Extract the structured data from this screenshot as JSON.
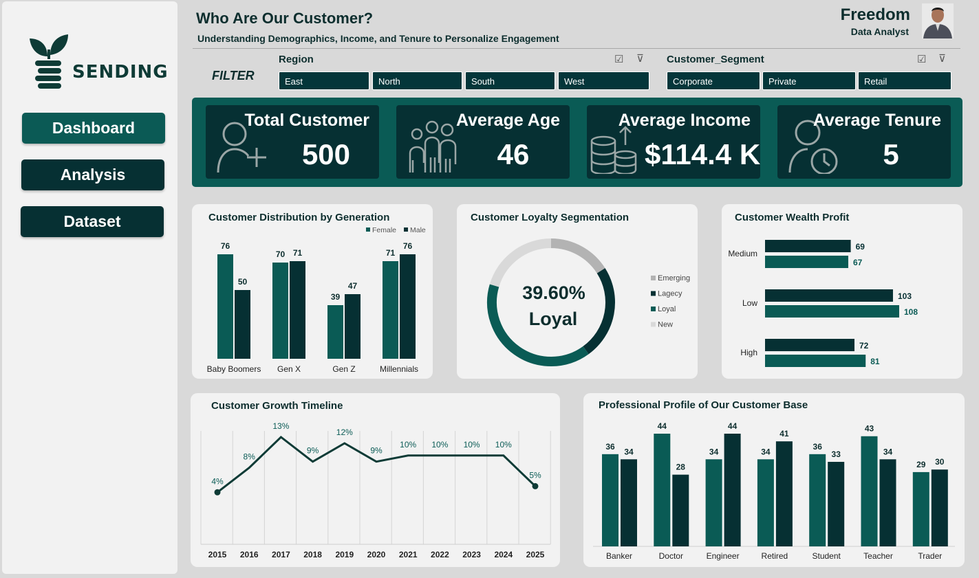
{
  "sidebar": {
    "logo_text": "SENDING",
    "nav": [
      {
        "label": "Dashboard"
      },
      {
        "label": "Analysis"
      },
      {
        "label": "Dataset"
      }
    ]
  },
  "header": {
    "title": "Who Are Our Customer?",
    "subtitle": "Understanding Demographics, Income, and Tenure to Personalize Engagement",
    "author_name": "Freedom",
    "author_role": "Data Analyst"
  },
  "filters": {
    "label": "FILTER",
    "region": {
      "title": "Region",
      "options": [
        "East",
        "North",
        "South",
        "West"
      ]
    },
    "segment": {
      "title": "Customer_Segment",
      "options": [
        "Corporate",
        "Private",
        "Retail"
      ]
    }
  },
  "kpis": [
    {
      "title": "Total Customer",
      "value": "500",
      "icon": "add-user-icon"
    },
    {
      "title": "Average Age",
      "value": "46",
      "icon": "family-icon"
    },
    {
      "title": "Average Income",
      "value": "$114.4 K",
      "icon": "coins-icon"
    },
    {
      "title": "Average Tenure",
      "value": "5",
      "icon": "user-clock-icon"
    }
  ],
  "colors": {
    "teal": "#0a5b55",
    "dark": "#063033",
    "panel": "#f2f2f2",
    "grey": "#b3b3b3",
    "light_grey": "#d9d9d9"
  },
  "chart_data": [
    {
      "id": "generation",
      "type": "bar",
      "title": "Customer Distribution by Generation",
      "categories": [
        "Baby Boomers",
        "Gen X",
        "Gen Z",
        "Millennials"
      ],
      "series": [
        {
          "name": "Female",
          "values": [
            76,
            70,
            39,
            71
          ],
          "color": "#0a5b55"
        },
        {
          "name": "Male",
          "values": [
            50,
            71,
            47,
            76
          ],
          "color": "#063033"
        }
      ],
      "legend": "top-right"
    },
    {
      "id": "loyalty",
      "type": "pie",
      "title": "Customer Loyalty Segmentation",
      "center_value": "39.60%",
      "center_label": "Loyal",
      "slices": [
        {
          "name": "Emerging",
          "color": "#b3b3b3"
        },
        {
          "name": "Lagecy",
          "color": "#063033"
        },
        {
          "name": "Loyal",
          "color": "#0a5b55"
        },
        {
          "name": "New",
          "color": "#d9d9d9"
        }
      ],
      "legend": "right"
    },
    {
      "id": "wealth",
      "type": "bar",
      "orientation": "horizontal",
      "title": "Customer Wealth Profit",
      "categories": [
        "Medium",
        "Low",
        "High"
      ],
      "series": [
        {
          "values": [
            69,
            103,
            72
          ],
          "color": "#063033"
        },
        {
          "values": [
            67,
            108,
            81
          ],
          "color": "#0a5b55"
        }
      ]
    },
    {
      "id": "growth",
      "type": "line",
      "title": "Customer Growth Timeline",
      "x": [
        "2015",
        "2016",
        "2017",
        "2018",
        "2019",
        "2020",
        "2021",
        "2022",
        "2023",
        "2024",
        "2025"
      ],
      "values": [
        4,
        8,
        13,
        9,
        12,
        9,
        10,
        10,
        10,
        10,
        5
      ],
      "labels": [
        "4%",
        "8%",
        "13%",
        "9%",
        "12%",
        "9%",
        "10%",
        "10%",
        "10%",
        "10%",
        "5%"
      ],
      "grid": "vertical"
    },
    {
      "id": "profession",
      "type": "bar",
      "title": "Professional Profile of Our Customer Base",
      "categories": [
        "Banker",
        "Doctor",
        "Engineer",
        "Retired",
        "Student",
        "Teacher",
        "Trader"
      ],
      "series": [
        {
          "values": [
            36,
            44,
            34,
            34,
            36,
            43,
            29
          ],
          "color": "#0a5b55"
        },
        {
          "values": [
            34,
            28,
            44,
            41,
            33,
            34,
            30
          ],
          "color": "#063033"
        }
      ]
    }
  ]
}
